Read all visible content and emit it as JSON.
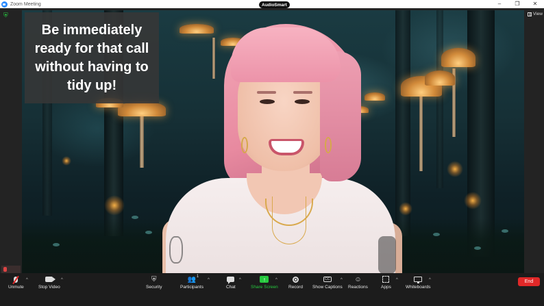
{
  "window": {
    "title": "Zoom Meeting",
    "controls": [
      "–",
      "❐",
      "✕"
    ]
  },
  "audio_badge": "AudioSmart",
  "top_right": {
    "view_label": "View"
  },
  "caption": "Be immediately ready for that call without having to tidy up!",
  "toolbar": {
    "unmute": "Unmute",
    "stop_video": "Stop Video",
    "security": "Security",
    "participants": "Participants",
    "participants_count": "1",
    "chat": "Chat",
    "share_screen": "Share Screen",
    "record": "Record",
    "captions": "Show Captions",
    "reactions": "Reactions",
    "apps": "Apps",
    "whiteboards": "Whiteboards",
    "end": "End",
    "caret": "^"
  },
  "colors": {
    "share_green": "#27c93f",
    "end_red": "#e02828",
    "toolbar_bg": "#1c1c1c"
  }
}
